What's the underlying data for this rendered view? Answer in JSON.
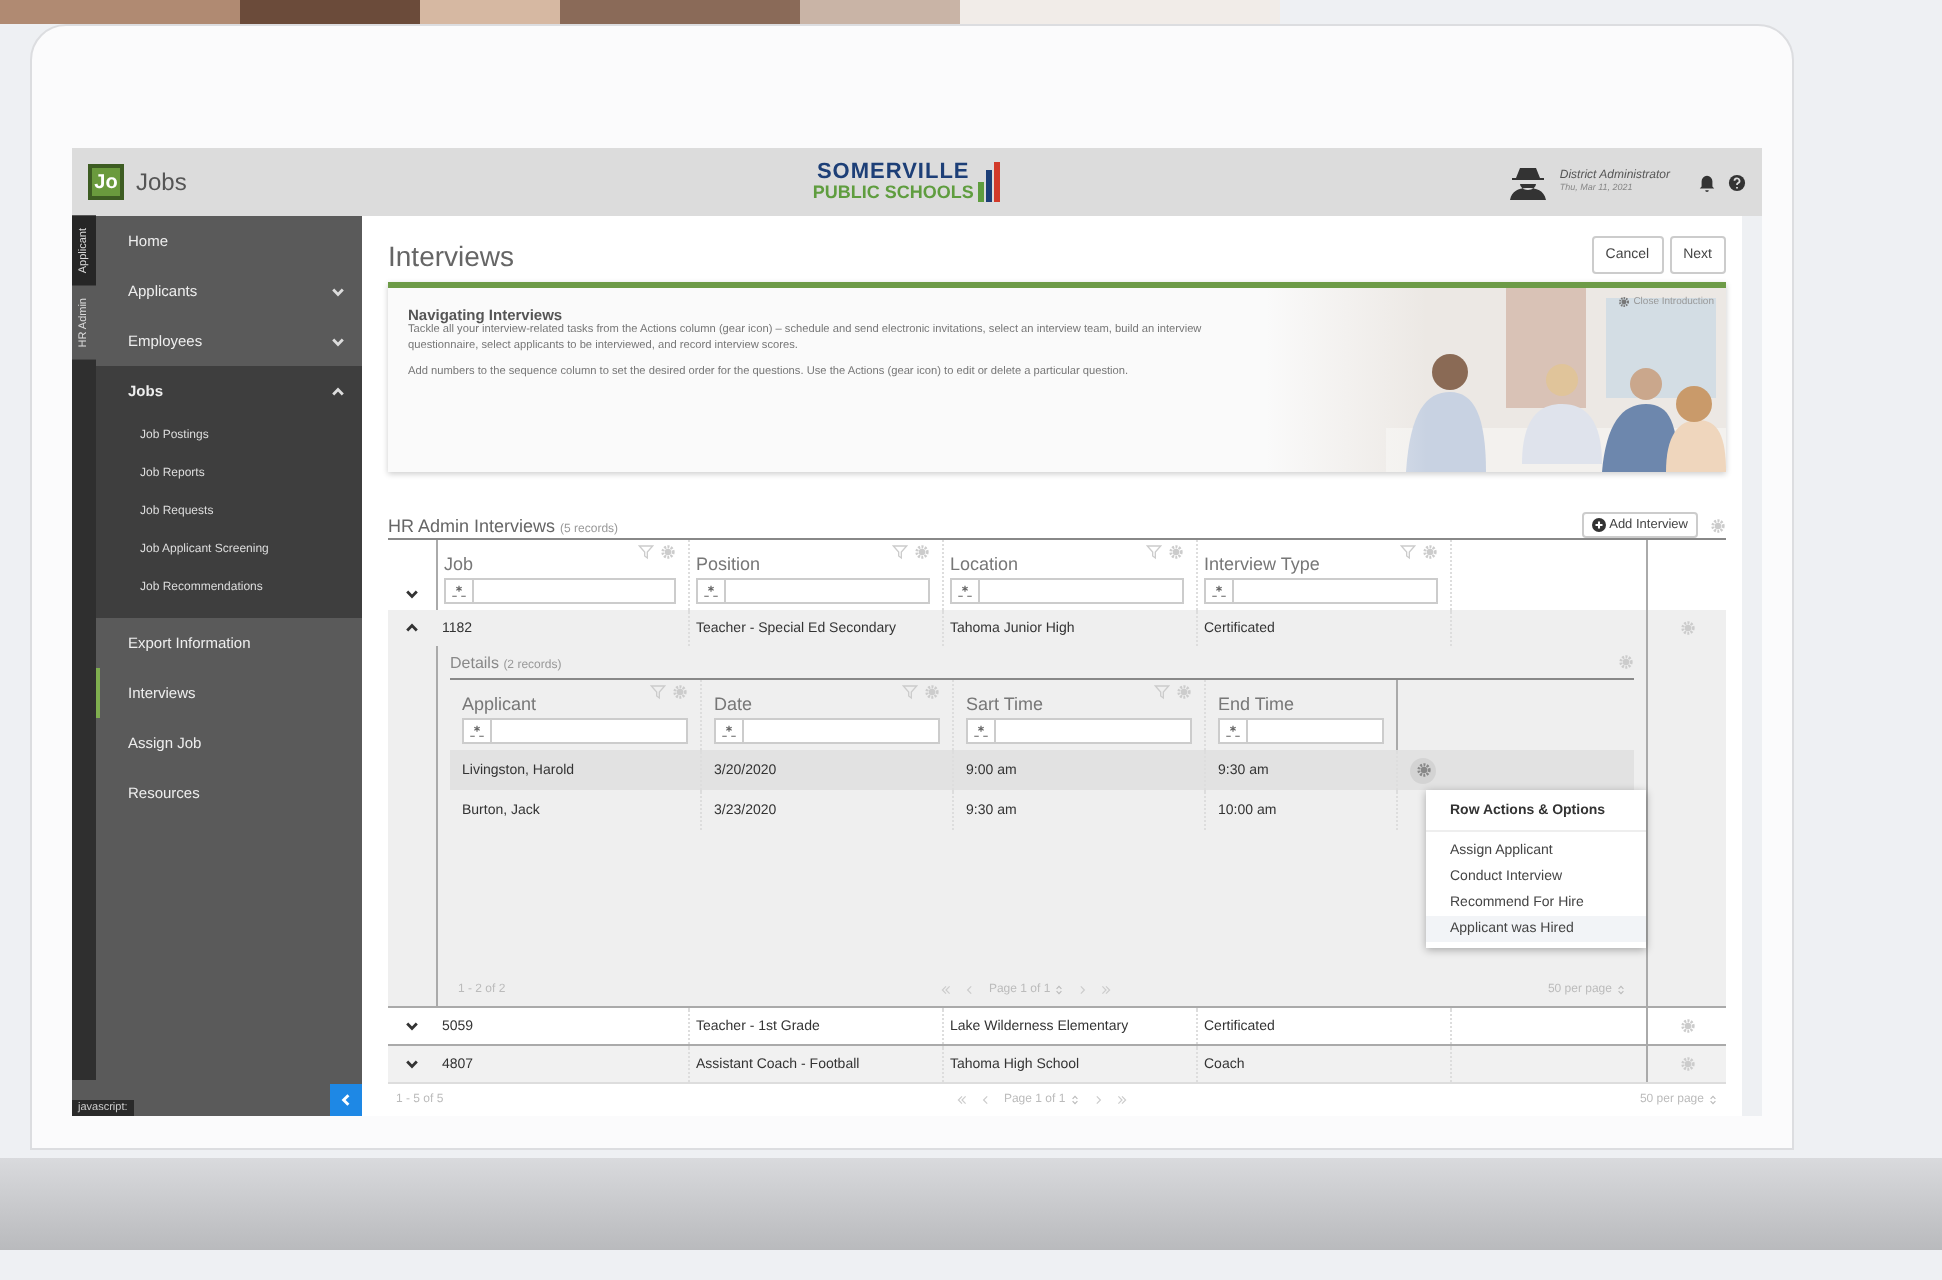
{
  "header": {
    "logo": "Jo",
    "app": "Jobs",
    "brand_top": "SOMERVILLE",
    "brand_bottom": "PUBLIC SCHOOLS",
    "user": "District Administrator",
    "date": "Thu, Mar 11, 2021"
  },
  "side_tabs": [
    {
      "label": "Applicant",
      "selected": false
    },
    {
      "label": "HR Admin",
      "selected": true
    }
  ],
  "nav": [
    {
      "label": "Home",
      "kind": "link",
      "selected": false
    },
    {
      "label": "Applicants",
      "kind": "group",
      "selected": false,
      "expanded": false
    },
    {
      "label": "Employees",
      "kind": "group",
      "selected": false,
      "expanded": false
    },
    {
      "label": "Jobs",
      "kind": "group",
      "selected": false,
      "expanded": true,
      "children": [
        {
          "label": "Job Postings",
          "selected": false
        },
        {
          "label": "Job Reports",
          "selected": false
        },
        {
          "label": "Job Requests",
          "selected": false
        },
        {
          "label": "Job Applicant Screening",
          "selected": false
        },
        {
          "label": "Job Recommendations",
          "selected": false
        }
      ]
    },
    {
      "label": "Export Information",
      "kind": "link",
      "selected": false
    },
    {
      "label": "Interviews",
      "kind": "link",
      "selected": true
    },
    {
      "label": "Assign Job",
      "kind": "link",
      "selected": false
    },
    {
      "label": "Resources",
      "kind": "link",
      "selected": false
    }
  ],
  "status_text": "javascript:",
  "page": {
    "title": "Interviews",
    "buttons": [
      "Cancel",
      "Next"
    ]
  },
  "intro": {
    "title": "Navigating Interviews",
    "close": "Close Introduction",
    "paragraphs": [
      "Tackle all your interview-related tasks from the Actions column (gear icon) – schedule and send electronic invitations, select an interview team, build an interview questionnaire, select applicants to be interviewed, and record interview scores.",
      "Add numbers to the sequence column to set the desired order for the questions. Use the Actions (gear icon) to edit or delete a particular question."
    ]
  },
  "grid": {
    "title": "HR Admin Interviews",
    "count": "(5 records)",
    "add_button": "Add Interview",
    "columns": [
      "Job",
      "Position",
      "Location",
      "Interview Type"
    ],
    "rows": [
      {
        "cells": [
          "1182",
          "Teacher - Special Ed Secondary",
          "Tahoma Junior High",
          "Certificated"
        ],
        "expanded": true,
        "details": {
          "title": "Details",
          "count": "(2 records)",
          "columns": [
            "Applicant",
            "Date",
            "Sart Time",
            "End Time"
          ],
          "rows": [
            {
              "cells": [
                "Livingston, Harold",
                "3/20/2020",
                "9:00 am",
                "9:30 am"
              ],
              "selected": true
            },
            {
              "cells": [
                "Burton, Jack",
                "3/23/2020",
                "9:30 am",
                "10:00 am"
              ],
              "selected": false
            }
          ],
          "footer": {
            "range": "1 - 2 of 2",
            "page": "Page 1 of 1",
            "per_page": "50 per page"
          },
          "menu": {
            "title": "Row Actions & Options",
            "items": [
              {
                "label": "Assign Applicant",
                "selected": false
              },
              {
                "label": "Conduct Interview",
                "selected": false
              },
              {
                "label": "Recommend For Hire",
                "selected": false
              },
              {
                "label": "Applicant was Hired",
                "selected": true
              }
            ]
          }
        }
      },
      {
        "cells": [
          "5059",
          "Teacher - 1st Grade",
          "Lake Wilderness Elementary",
          "Certificated"
        ],
        "expanded": false
      },
      {
        "cells": [
          "4807",
          "Assistant Coach - Football",
          "Tahoma High School",
          "Coach"
        ],
        "expanded": false
      }
    ],
    "footer": {
      "range": "1 - 5 of 5",
      "page": "Page 1 of 1",
      "per_page": "50 per page"
    }
  }
}
